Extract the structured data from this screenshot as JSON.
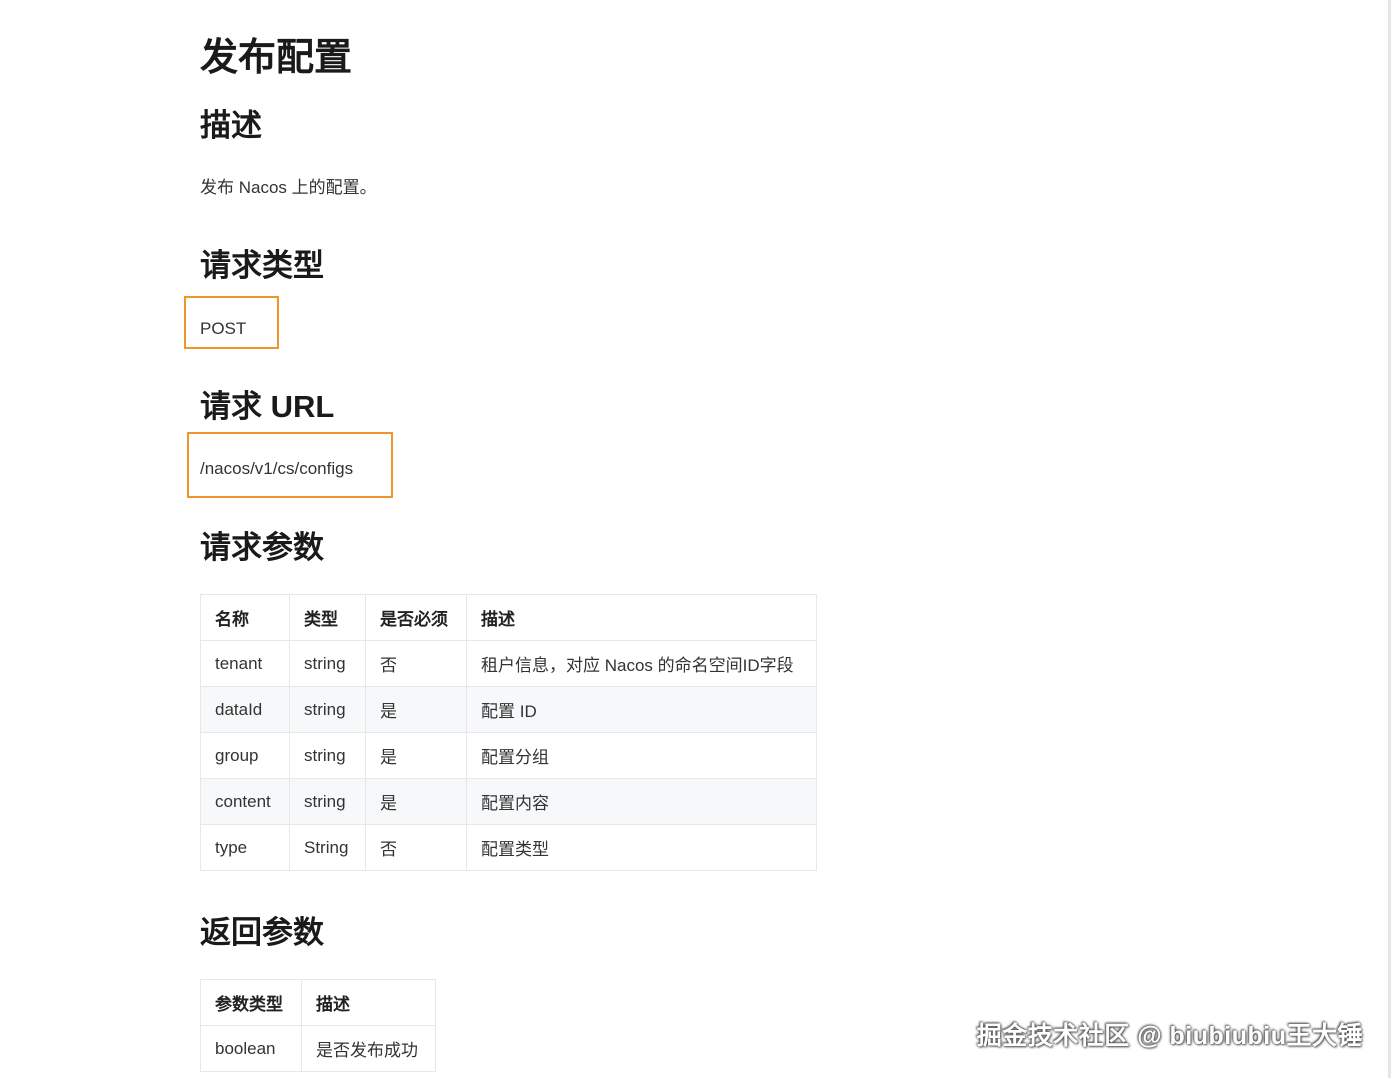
{
  "page": {
    "title": "发布配置"
  },
  "description": {
    "heading": "描述",
    "text": "发布 Nacos 上的配置。"
  },
  "request_method": {
    "heading": "请求类型",
    "value": "POST"
  },
  "request_url": {
    "heading": "请求 URL",
    "value": "/nacos/v1/cs/configs"
  },
  "request_params": {
    "heading": "请求参数",
    "columns": [
      "名称",
      "类型",
      "是否必须",
      "描述"
    ],
    "rows": [
      [
        "tenant",
        "string",
        "否",
        "租户信息，对应 Nacos 的命名空间ID字段"
      ],
      [
        "dataId",
        "string",
        "是",
        "配置 ID"
      ],
      [
        "group",
        "string",
        "是",
        "配置分组"
      ],
      [
        "content",
        "string",
        "是",
        "配置内容"
      ],
      [
        "type",
        "String",
        "否",
        "配置类型"
      ]
    ]
  },
  "return_params": {
    "heading": "返回参数",
    "columns": [
      "参数类型",
      "描述"
    ],
    "rows": [
      [
        "boolean",
        "是否发布成功"
      ]
    ]
  },
  "watermark": {
    "text": "掘金技术社区 @ biubiubiu王大锤"
  },
  "colors": {
    "highlight_border": "#f0952e",
    "zebra_row": "#f6f8fa",
    "table_border": "#e8e8e8"
  }
}
